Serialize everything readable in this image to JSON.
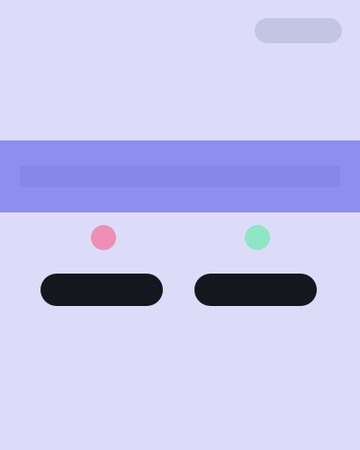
{
  "topbar": {
    "pill_label": ""
  },
  "hero": {
    "title": ""
  },
  "banner": {
    "text": ""
  },
  "choices": [
    {
      "button_label": "",
      "caption": "",
      "icon": "pink-circle-icon",
      "icon_color": "#ee8fb6"
    },
    {
      "button_label": "",
      "caption": "",
      "icon": "green-circle-icon",
      "icon_color": "#8fe6c2"
    }
  ],
  "colors": {
    "background": "#dcdcf9",
    "banner": "#8e8ef0",
    "button": "#16161e",
    "title": "#1a1a26"
  }
}
